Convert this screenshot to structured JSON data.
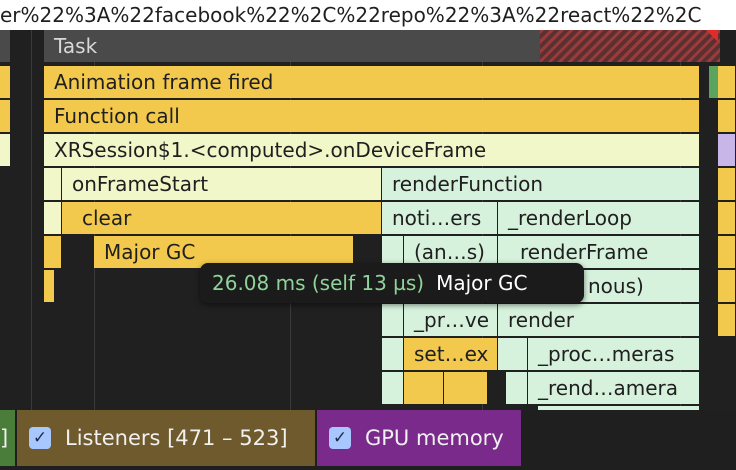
{
  "url_fragment": "er%22%3A%22facebook%22%2C%22repo%22%3A%22react%22%2C",
  "flame": {
    "task_label": "Task",
    "animation_frame": "Animation frame fired",
    "function_call": "Function call",
    "xrsession": "XRSession$1.<computed>.onDeviceFrame",
    "on_frame_start": "onFrameStart",
    "render_function": "renderFunction",
    "clear": "clear",
    "noti_ers": "noti…ers",
    "render_loop": "_renderLoop",
    "major_gc": "Major GC",
    "an_s": "(an…s)",
    "render_frame": "renderFrame",
    "nous": "nous)",
    "pr_ve": "_pr…ve",
    "render": "render",
    "set_ex": "set…ex",
    "proc_meras": "_proc…meras",
    "rend_amera": "_rend…amera"
  },
  "tooltip": {
    "time": "26.08 ms (self 13 µs)",
    "name": "Major GC"
  },
  "legend": {
    "bracket": "]",
    "listeners_label": "Listeners [471 – 523]",
    "gpu_label": "GPU memory",
    "checkmark": "✓"
  },
  "colors": {
    "event_yellow": "#f2c94c",
    "pale_yellow": "#f1f7c8",
    "mint": "#d6f1dc",
    "listeners_track": "#6e5a2c",
    "gpu_track": "#7a2a8a",
    "green_track": "#4a7c3a",
    "tooltip_time": "#8fd39a"
  }
}
